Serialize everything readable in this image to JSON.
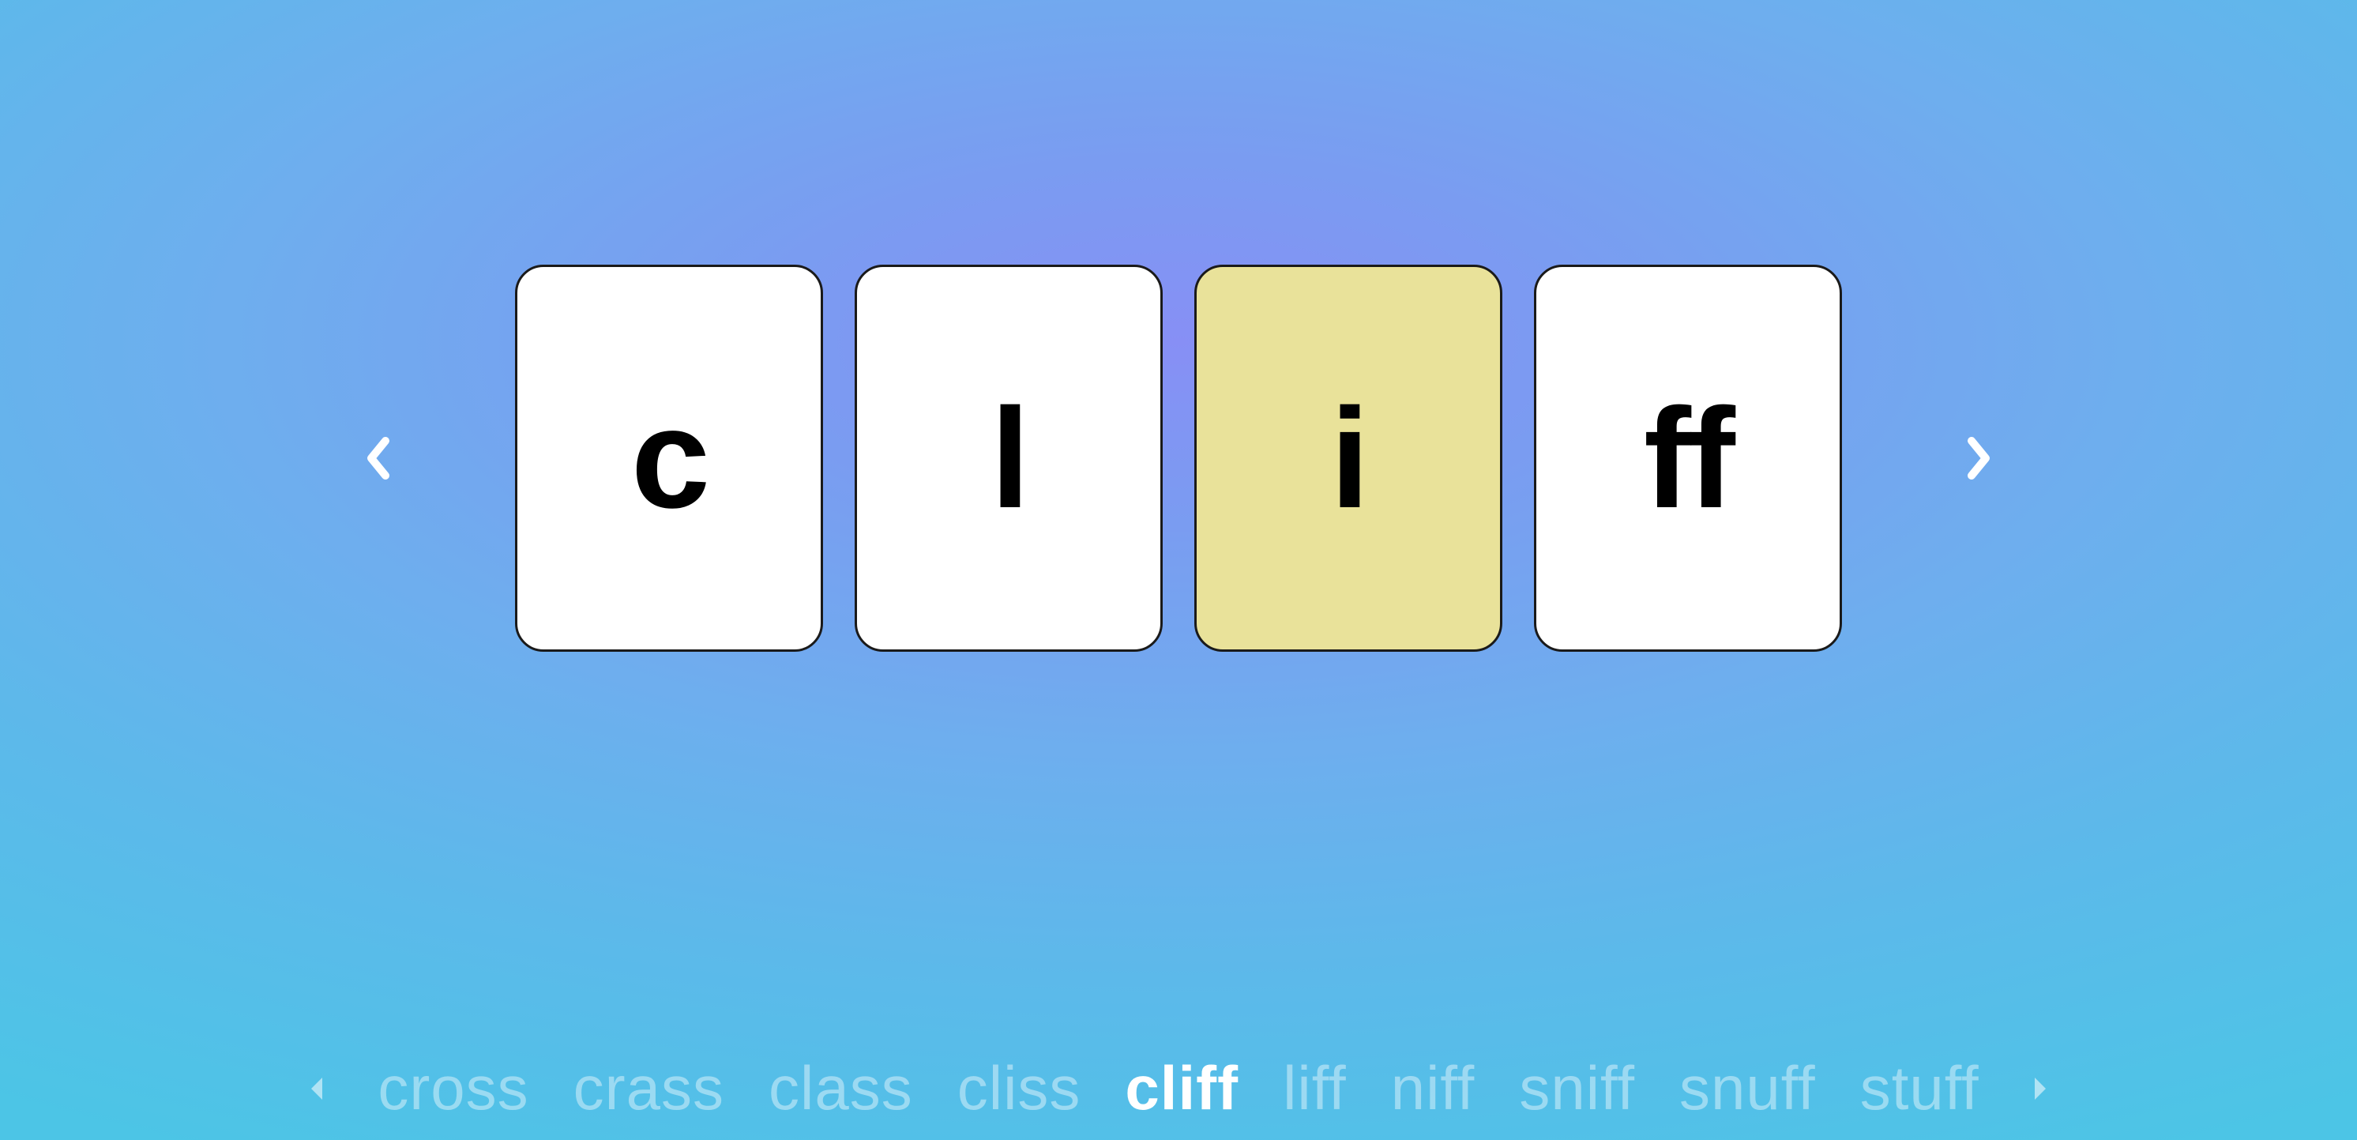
{
  "colors": {
    "card_bg": "#ffffff",
    "card_highlight": "#e9e29a",
    "card_border": "#1a1a1a",
    "text": "#000000",
    "strip_inactive": "rgba(255,255,255,0.42)",
    "strip_active": "#ffffff"
  },
  "main": {
    "cards": [
      {
        "label": "c",
        "highlighted": false
      },
      {
        "label": "l",
        "highlighted": false
      },
      {
        "label": "i",
        "highlighted": true
      },
      {
        "label": "ff",
        "highlighted": false
      }
    ]
  },
  "strip": {
    "words": [
      {
        "label": "cross",
        "active": false
      },
      {
        "label": "crass",
        "active": false
      },
      {
        "label": "class",
        "active": false
      },
      {
        "label": "cliss",
        "active": false
      },
      {
        "label": "cliff",
        "active": true
      },
      {
        "label": "liff",
        "active": false
      },
      {
        "label": "niff",
        "active": false
      },
      {
        "label": "sniff",
        "active": false
      },
      {
        "label": "snuff",
        "active": false
      },
      {
        "label": "stuff",
        "active": false
      }
    ]
  }
}
